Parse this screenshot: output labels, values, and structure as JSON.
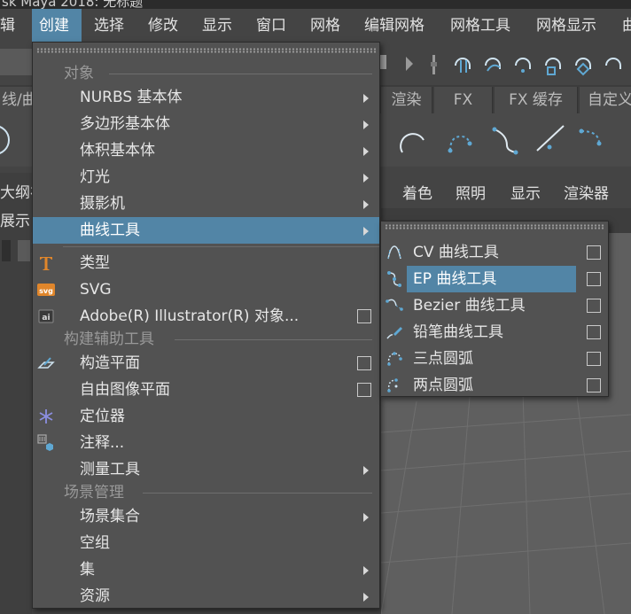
{
  "app": {
    "title": "sk Maya 2018: 无标题"
  },
  "menubar": {
    "items": [
      {
        "label": "辑"
      },
      {
        "label": "创建",
        "active": true
      },
      {
        "label": "选择"
      },
      {
        "label": "修改"
      },
      {
        "label": "显示"
      },
      {
        "label": "窗口"
      },
      {
        "label": "网格"
      },
      {
        "label": "编辑网格"
      },
      {
        "label": "网格工具"
      },
      {
        "label": "网格显示"
      },
      {
        "label": "曲"
      }
    ]
  },
  "shelf": {
    "tabs": [
      "渲染",
      "FX",
      "FX 缓存",
      "自定义"
    ],
    "partial_label": "线/曲"
  },
  "left_panel": {
    "labels": [
      "大纲视",
      "展示"
    ]
  },
  "viewport_menu": {
    "items": [
      "着色",
      "照明",
      "显示",
      "渲染器"
    ]
  },
  "create_menu": {
    "sections": {
      "objects": "对象",
      "construction_aids": "构建辅助工具",
      "scene_management": "场景管理"
    },
    "items": [
      {
        "label": "NURBS 基本体",
        "submenu": true
      },
      {
        "label": "多边形基本体",
        "submenu": true
      },
      {
        "label": "体积基本体",
        "submenu": true
      },
      {
        "label": "灯光",
        "submenu": true
      },
      {
        "label": "摄影机",
        "submenu": true
      },
      {
        "label": "曲线工具",
        "submenu": true,
        "highlighted": true
      },
      {
        "label": "类型",
        "icon": "type-t-icon"
      },
      {
        "label": "SVG",
        "icon": "svg-icon"
      },
      {
        "label": "Adobe(R) Illustrator(R) 对象...",
        "icon": "ai-icon",
        "option_box": true
      },
      {
        "label": "构造平面",
        "icon": "construction-plane-icon",
        "option_box": true
      },
      {
        "label": "自由图像平面",
        "option_box": true
      },
      {
        "label": "定位器",
        "icon": "locator-icon"
      },
      {
        "label": "注释...",
        "icon": "annotation-icon"
      },
      {
        "label": "测量工具",
        "submenu": true
      },
      {
        "label": "场景集合",
        "submenu": true
      },
      {
        "label": "空组"
      },
      {
        "label": "集",
        "submenu": true
      },
      {
        "label": "资源",
        "submenu": true
      }
    ]
  },
  "curve_tools_submenu": {
    "items": [
      {
        "label": "CV 曲线工具",
        "icon": "cv-curve-icon"
      },
      {
        "label": "EP 曲线工具",
        "icon": "ep-curve-icon",
        "highlighted": true
      },
      {
        "label": "Bezier 曲线工具",
        "icon": "bezier-curve-icon"
      },
      {
        "label": "铅笔曲线工具",
        "icon": "pencil-curve-icon"
      },
      {
        "label": "三点圆弧",
        "icon": "three-point-arc-icon"
      },
      {
        "label": "两点圆弧",
        "icon": "two-point-arc-icon"
      }
    ]
  },
  "colors": {
    "highlight": "#5285a6",
    "menu_bg": "#525252",
    "app_bg": "#444444",
    "icon_blue": "#7fb3d5"
  }
}
